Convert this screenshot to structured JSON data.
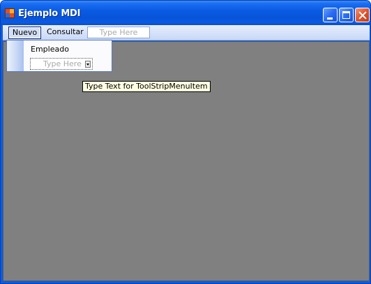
{
  "window": {
    "title": "Ejemplo MDI"
  },
  "icons": {
    "app": "app-icon",
    "minimize": "minimize-icon",
    "maximize": "maximize-icon",
    "close": "close-icon",
    "dropdown_arrow": "chevron-down-icon"
  },
  "menubar": {
    "items": [
      {
        "label": "Nuevo"
      },
      {
        "label": "Consultar"
      }
    ],
    "type_here_placeholder": "Type Here"
  },
  "dropdown": {
    "items": [
      {
        "label": "Empleado"
      }
    ],
    "type_here_placeholder": "Type Here"
  },
  "tooltip": {
    "text": "Type Text for ToolStripMenuItem"
  },
  "colors": {
    "titlebar": "#0a5be3",
    "mdi_background": "#808080",
    "menubar": "#c7d8f7",
    "close_button": "#e0542f",
    "tooltip_background": "#ffffe1"
  }
}
